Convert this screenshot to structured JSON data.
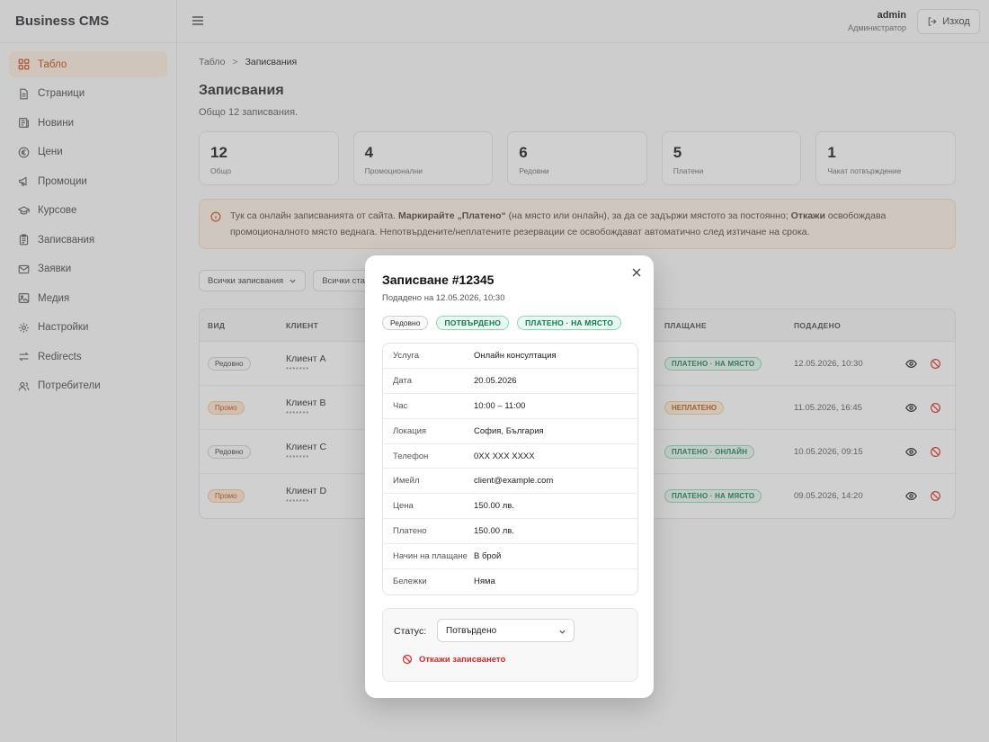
{
  "app": {
    "title": "Business CMS"
  },
  "sidebar": {
    "items": [
      {
        "label": "Табло",
        "icon": "dashboard-icon"
      },
      {
        "label": "Страници",
        "icon": "page-icon"
      },
      {
        "label": "Новини",
        "icon": "news-icon"
      },
      {
        "label": "Цени",
        "icon": "euro-icon"
      },
      {
        "label": "Промоции",
        "icon": "megaphone-icon"
      },
      {
        "label": "Курсове",
        "icon": "graduation-cap-icon"
      },
      {
        "label": "Записвания",
        "icon": "clipboard-icon"
      },
      {
        "label": "Заявки",
        "icon": "inbox-icon"
      },
      {
        "label": "Медия",
        "icon": "image-icon"
      },
      {
        "label": "Настройки",
        "icon": "gear-icon"
      },
      {
        "label": "Redirects",
        "icon": "arrows-icon"
      },
      {
        "label": "Потребители",
        "icon": "users-icon"
      }
    ]
  },
  "topbar": {
    "user_name": "admin",
    "user_role": "Администратор",
    "logout_label": "Изход"
  },
  "breadcrumb": {
    "home": "Табло",
    "sep": ">",
    "current": "Записвания"
  },
  "page": {
    "title": "Записвания",
    "subtitle": "Общо 12 записвания."
  },
  "stats": [
    {
      "value": "12",
      "label": "Общо"
    },
    {
      "value": "4",
      "label": "Промоционални"
    },
    {
      "value": "6",
      "label": "Редовни"
    },
    {
      "value": "5",
      "label": "Платени"
    },
    {
      "value": "1",
      "label": "Чакат потвърждение"
    }
  ],
  "notice": {
    "t1": "Тук са онлайн записванията от сайта. ",
    "b1": "Маркирайте „Платено“",
    "t2": " (на място или онлайн), за да се задържи мястото за постоянно; ",
    "b2": "Откажи",
    "t3": " освобождава промоционалното място веднага. Непотвърдените/неплатените резервации се освобождават автоматично след изтичане на срока."
  },
  "filters": {
    "type": "Всички записвания",
    "status": "Всички статуси"
  },
  "table": {
    "headers": {
      "type": "ВИД",
      "client": "КЛИЕНТ",
      "payment": "ПЛАЩАНЕ",
      "submitted": "ПОДАДЕНО"
    },
    "rows": [
      {
        "type": "Редовно",
        "name": "Клиент A",
        "mask": "*******",
        "payment": "ПЛАТЕНО · НА МЯСТО",
        "date": "12.05.2026, 10:30"
      },
      {
        "type": "Промо",
        "name": "Клиент B",
        "mask": "*******",
        "payment": "НЕПЛАТЕНО",
        "date": "11.05.2026, 16:45"
      },
      {
        "type": "Редовно",
        "name": "Клиент C",
        "mask": "*******",
        "payment": "ПЛАТЕНО · ОНЛАЙН",
        "date": "10.05.2026, 09:15"
      },
      {
        "type": "Промо",
        "name": "Клиент D",
        "mask": "*******",
        "payment": "ПЛАТЕНО · НА МЯСТО",
        "date": "09.05.2026, 14:20"
      }
    ]
  },
  "modal": {
    "title": "Записване #12345",
    "subtitle": "Подадено на 12.05.2026, 10:30",
    "badges": {
      "type": "Редовно",
      "status": "ПОТВЪРДЕНО",
      "payment": "ПЛАТЕНО · НА МЯСТО"
    },
    "details": [
      {
        "k": "Услуга",
        "v": "Онлайн консултация"
      },
      {
        "k": "Дата",
        "v": "20.05.2026"
      },
      {
        "k": "Час",
        "v": "10:00 – 11:00"
      },
      {
        "k": "Локация",
        "v": "София, България"
      },
      {
        "k": "Телефон",
        "v": "0XX XXX XXXX"
      },
      {
        "k": "Имейл",
        "v": "client@example.com"
      },
      {
        "k": "Цена",
        "v": "150.00 лв."
      },
      {
        "k": "Платено",
        "v": "150.00 лв."
      },
      {
        "k": "Начин на плащане",
        "v": "В брой"
      },
      {
        "k": "Бележки",
        "v": "Няма"
      }
    ],
    "status_label": "Статус:",
    "status_value": "Потвърдено",
    "cancel_label": "Откажи записването"
  },
  "colors": {
    "accent": "#c2410c",
    "danger": "#dc2626",
    "success": "#0f7a4a"
  }
}
